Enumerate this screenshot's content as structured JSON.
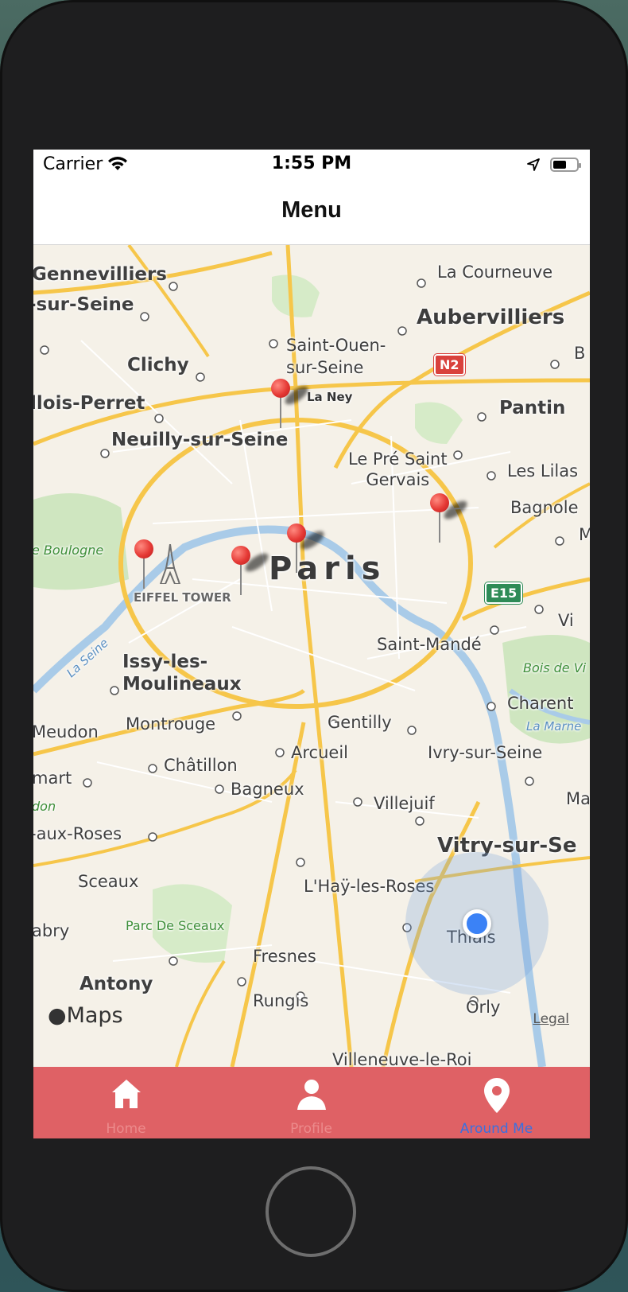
{
  "status_bar": {
    "carrier": "Carrier",
    "time": "1:55 PM"
  },
  "nav": {
    "title": "Menu"
  },
  "map": {
    "city": "Paris",
    "labels": {
      "gennevilliers": "Gennevilliers",
      "sur_seine_w": "-sur-Seine",
      "clichy": "Clichy",
      "levallois": "llois-Perret",
      "neuilly": "Neuilly-sur-Seine",
      "saint_ouen": "Saint-Ouen-\nsur-Seine",
      "la_courneuve": "La Courneuve",
      "aubervilliers": "Aubervilliers",
      "pantin": "Pantin",
      "le_pre": "Le Pré Saint\nGervais",
      "les_lilas": "Les Lilas",
      "bagnolet": "Bagnole",
      "bois_boulogne": "e Boulogne",
      "eiffel": "EIFFEL TOWER",
      "la_seine": "La Seine",
      "issy": "Issy-les-\nMoulineaux",
      "saint_mande": "Saint-Mandé",
      "bois_vincennes": "Bois de Vi",
      "vincennes": "Vi",
      "charenton": "Charent",
      "la_marne": "La Marne",
      "meudon": "Meudon",
      "montrouge": "Montrouge",
      "gentilly": "Gentilly",
      "arcueil": "Arcueil",
      "ivry": "Ivry-sur-Seine",
      "chatillon": "Châtillon",
      "clamart": "mart",
      "bagneux": "Bagneux",
      "villejuif": "Villejuif",
      "maisons": "Mai",
      "don": "don",
      "fontenay": "-aux-Roses",
      "vitry": "Vitry-sur-Se",
      "sceaux": "Sceaux",
      "lhay": "L'Haÿ-les-Roses",
      "parc_sceaux": "Parc De Sceaux",
      "chatenay": "abry",
      "thiais": "Thiais",
      "antony": "Antony",
      "fresnes": "Fresnes",
      "rungis": "Rungis",
      "orly": "Orly",
      "villeneuve": "Villeneuve-le-Roi",
      "la_ney": "La Ney",
      "b_edge": "B",
      "m_edge": "M"
    },
    "badges": {
      "n2": "N2",
      "e15": "E15"
    },
    "attribution": "Maps",
    "legal": "Legal"
  },
  "tabs": [
    {
      "label": "Home",
      "icon": "home-icon",
      "active": false
    },
    {
      "label": "Profile",
      "icon": "person-icon",
      "active": false
    },
    {
      "label": "Around Me",
      "icon": "location-pin-icon",
      "active": true
    }
  ],
  "colors": {
    "tab_bar": "#df6165",
    "active_tab": "#3a70e0",
    "pin": "#e53935",
    "user_dot": "#3b82f6"
  }
}
